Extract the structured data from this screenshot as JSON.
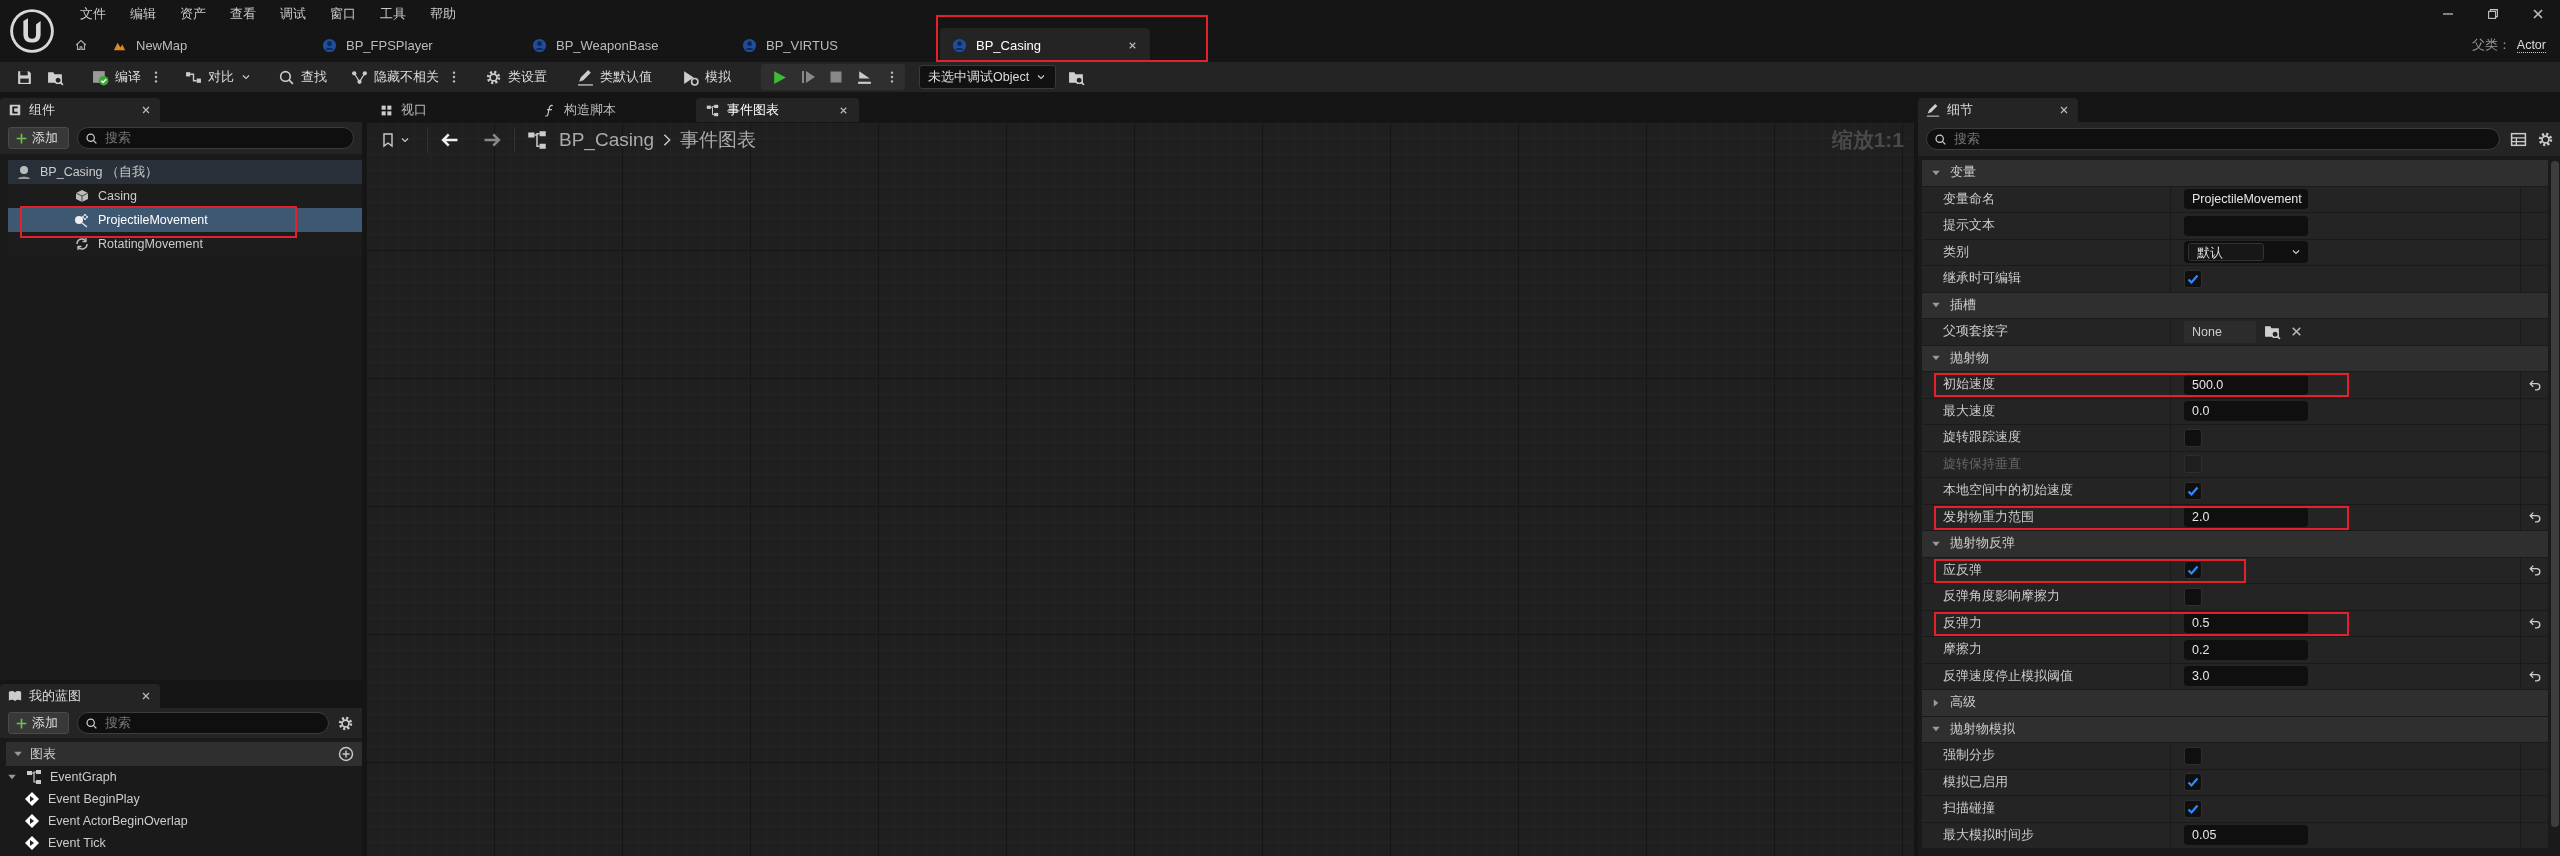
{
  "menu": [
    "文件",
    "编辑",
    "资产",
    "查看",
    "调试",
    "窗口",
    "工具",
    "帮助"
  ],
  "document_tabs": [
    {
      "kind": "level",
      "label": "NewMap",
      "selected": false,
      "marked": false
    },
    {
      "kind": "blueprint",
      "label": "BP_FPSPlayer",
      "selected": false,
      "marked": false
    },
    {
      "kind": "blueprint",
      "label": "BP_WeaponBase",
      "selected": false,
      "marked": false
    },
    {
      "kind": "blueprint",
      "label": "BP_VIRTUS",
      "selected": false,
      "marked": false
    },
    {
      "kind": "blueprint",
      "label": "BP_Casing",
      "selected": true,
      "marked": true
    }
  ],
  "parent_class": {
    "label": "父类：",
    "value": "Actor"
  },
  "toolbar": [
    {
      "kind": "save"
    },
    {
      "kind": "browse"
    },
    {
      "kind": "compile",
      "label": "编译"
    },
    {
      "kind": "more"
    },
    {
      "kind": "diff",
      "label": "对比"
    },
    {
      "kind": "find",
      "label": "查找"
    },
    {
      "kind": "hide",
      "label": "隐藏不相关"
    },
    {
      "kind": "more"
    },
    {
      "kind": "settings",
      "label": "类设置"
    },
    {
      "kind": "defaults",
      "label": "类默认值"
    },
    {
      "kind": "simulate",
      "label": "模拟"
    },
    {
      "kind": "play-group"
    },
    {
      "kind": "debug",
      "label": "未选中调试Object"
    },
    {
      "kind": "debug-browse"
    }
  ],
  "components": {
    "title": "组件",
    "add_label": "添加",
    "search_placeholder": "搜索",
    "tree": [
      {
        "kind": "actor",
        "label": "BP_Casing （自我）",
        "selected": false,
        "marked": false,
        "children": [
          {
            "kind": "mesh",
            "label": "Casing",
            "selected": false,
            "marked": false
          },
          {
            "kind": "projectile",
            "label": "ProjectileMovement",
            "selected": true,
            "marked": true
          },
          {
            "kind": "rotating",
            "label": "RotatingMovement",
            "selected": false,
            "marked": false
          }
        ]
      }
    ]
  },
  "editor_tabs": [
    {
      "kind": "viewport",
      "label": "视口",
      "selected": false
    },
    {
      "kind": "function",
      "label": "构造脚本",
      "selected": false
    },
    {
      "kind": "graph",
      "label": "事件图表",
      "selected": true
    }
  ],
  "graph": {
    "breadcrumb": [
      "BP_Casing",
      "事件图表"
    ],
    "zoom": "缩放1:1"
  },
  "my_blueprint": {
    "title": "我的蓝图",
    "add_label": "添加",
    "search_placeholder": "搜索",
    "sections": [
      {
        "label": "图表",
        "expanded": true,
        "children": [
          {
            "kind": "graph",
            "label": "EventGraph",
            "expanded": true,
            "children": [
              {
                "kind": "event",
                "label": "Event BeginPlay"
              },
              {
                "kind": "event",
                "label": "Event ActorBeginOverlap"
              },
              {
                "kind": "event",
                "label": "Event Tick"
              }
            ]
          }
        ]
      }
    ]
  },
  "details": {
    "title": "细节",
    "search_placeholder": "搜索",
    "rows": [
      {
        "kind": "section",
        "label": "变量",
        "expanded": true
      },
      {
        "kind": "text",
        "label": "变量命名",
        "value": "ProjectileMovement",
        "disabled": false,
        "resettable": false,
        "marked": false
      },
      {
        "kind": "text",
        "label": "提示文本",
        "disabled": false,
        "resettable": false,
        "marked": false
      },
      {
        "kind": "dropdown",
        "label": "类别",
        "value": "默认",
        "disabled": false,
        "resettable": false,
        "marked": false
      },
      {
        "kind": "checkbox",
        "label": "继承时可编辑",
        "checked": true,
        "disabled": false,
        "resettable": false,
        "marked": false
      },
      {
        "kind": "section",
        "label": "插槽",
        "expanded": true
      },
      {
        "kind": "socket",
        "label": "父项套接字",
        "value": "None",
        "disabled": false,
        "resettable": false,
        "marked": false
      },
      {
        "kind": "section",
        "label": "抛射物",
        "expanded": true
      },
      {
        "kind": "text",
        "label": "初始速度",
        "value": "500.0",
        "disabled": false,
        "resettable": true,
        "marked": true
      },
      {
        "kind": "text",
        "label": "最大速度",
        "value": "0.0",
        "disabled": false,
        "resettable": false,
        "marked": false
      },
      {
        "kind": "checkbox",
        "label": "旋转跟踪速度",
        "checked": false,
        "disabled": false,
        "resettable": false,
        "marked": false
      },
      {
        "kind": "checkbox",
        "label": "旋转保持垂直",
        "checked": false,
        "disabled": true,
        "resettable": false,
        "marked": false
      },
      {
        "kind": "checkbox",
        "label": "本地空间中的初始速度",
        "checked": true,
        "disabled": false,
        "resettable": false,
        "marked": false
      },
      {
        "kind": "text",
        "label": "发射物重力范围",
        "value": "2.0",
        "disabled": false,
        "resettable": true,
        "marked": true
      },
      {
        "kind": "section",
        "label": "抛射物反弹",
        "expanded": true
      },
      {
        "kind": "checkbox",
        "label": "应反弹",
        "checked": true,
        "disabled": false,
        "resettable": true,
        "marked": true
      },
      {
        "kind": "checkbox",
        "label": "反弹角度影响摩擦力",
        "checked": false,
        "disabled": false,
        "resettable": false,
        "marked": false
      },
      {
        "kind": "text",
        "label": "反弹力",
        "value": "0.5",
        "disabled": false,
        "resettable": true,
        "marked": true
      },
      {
        "kind": "text",
        "label": "摩擦力",
        "value": "0.2",
        "disabled": false,
        "resettable": false,
        "marked": false
      },
      {
        "kind": "text",
        "label": "反弹速度停止模拟阈值",
        "value": "3.0",
        "disabled": false,
        "resettable": true,
        "marked": false
      },
      {
        "kind": "section",
        "label": "高级",
        "expanded": false
      },
      {
        "kind": "section",
        "label": "抛射物模拟",
        "expanded": true
      },
      {
        "kind": "checkbox",
        "label": "强制分步",
        "checked": false,
        "disabled": false,
        "resettable": false,
        "marked": false
      },
      {
        "kind": "checkbox",
        "label": "模拟已启用",
        "checked": true,
        "disabled": false,
        "resettable": false,
        "marked": false
      },
      {
        "kind": "checkbox",
        "label": "扫描碰撞",
        "checked": true,
        "disabled": false,
        "resettable": false,
        "marked": false
      },
      {
        "kind": "text",
        "label": "最大模拟时间步",
        "value": "0.05",
        "disabled": false,
        "resettable": false,
        "marked": false
      }
    ]
  }
}
